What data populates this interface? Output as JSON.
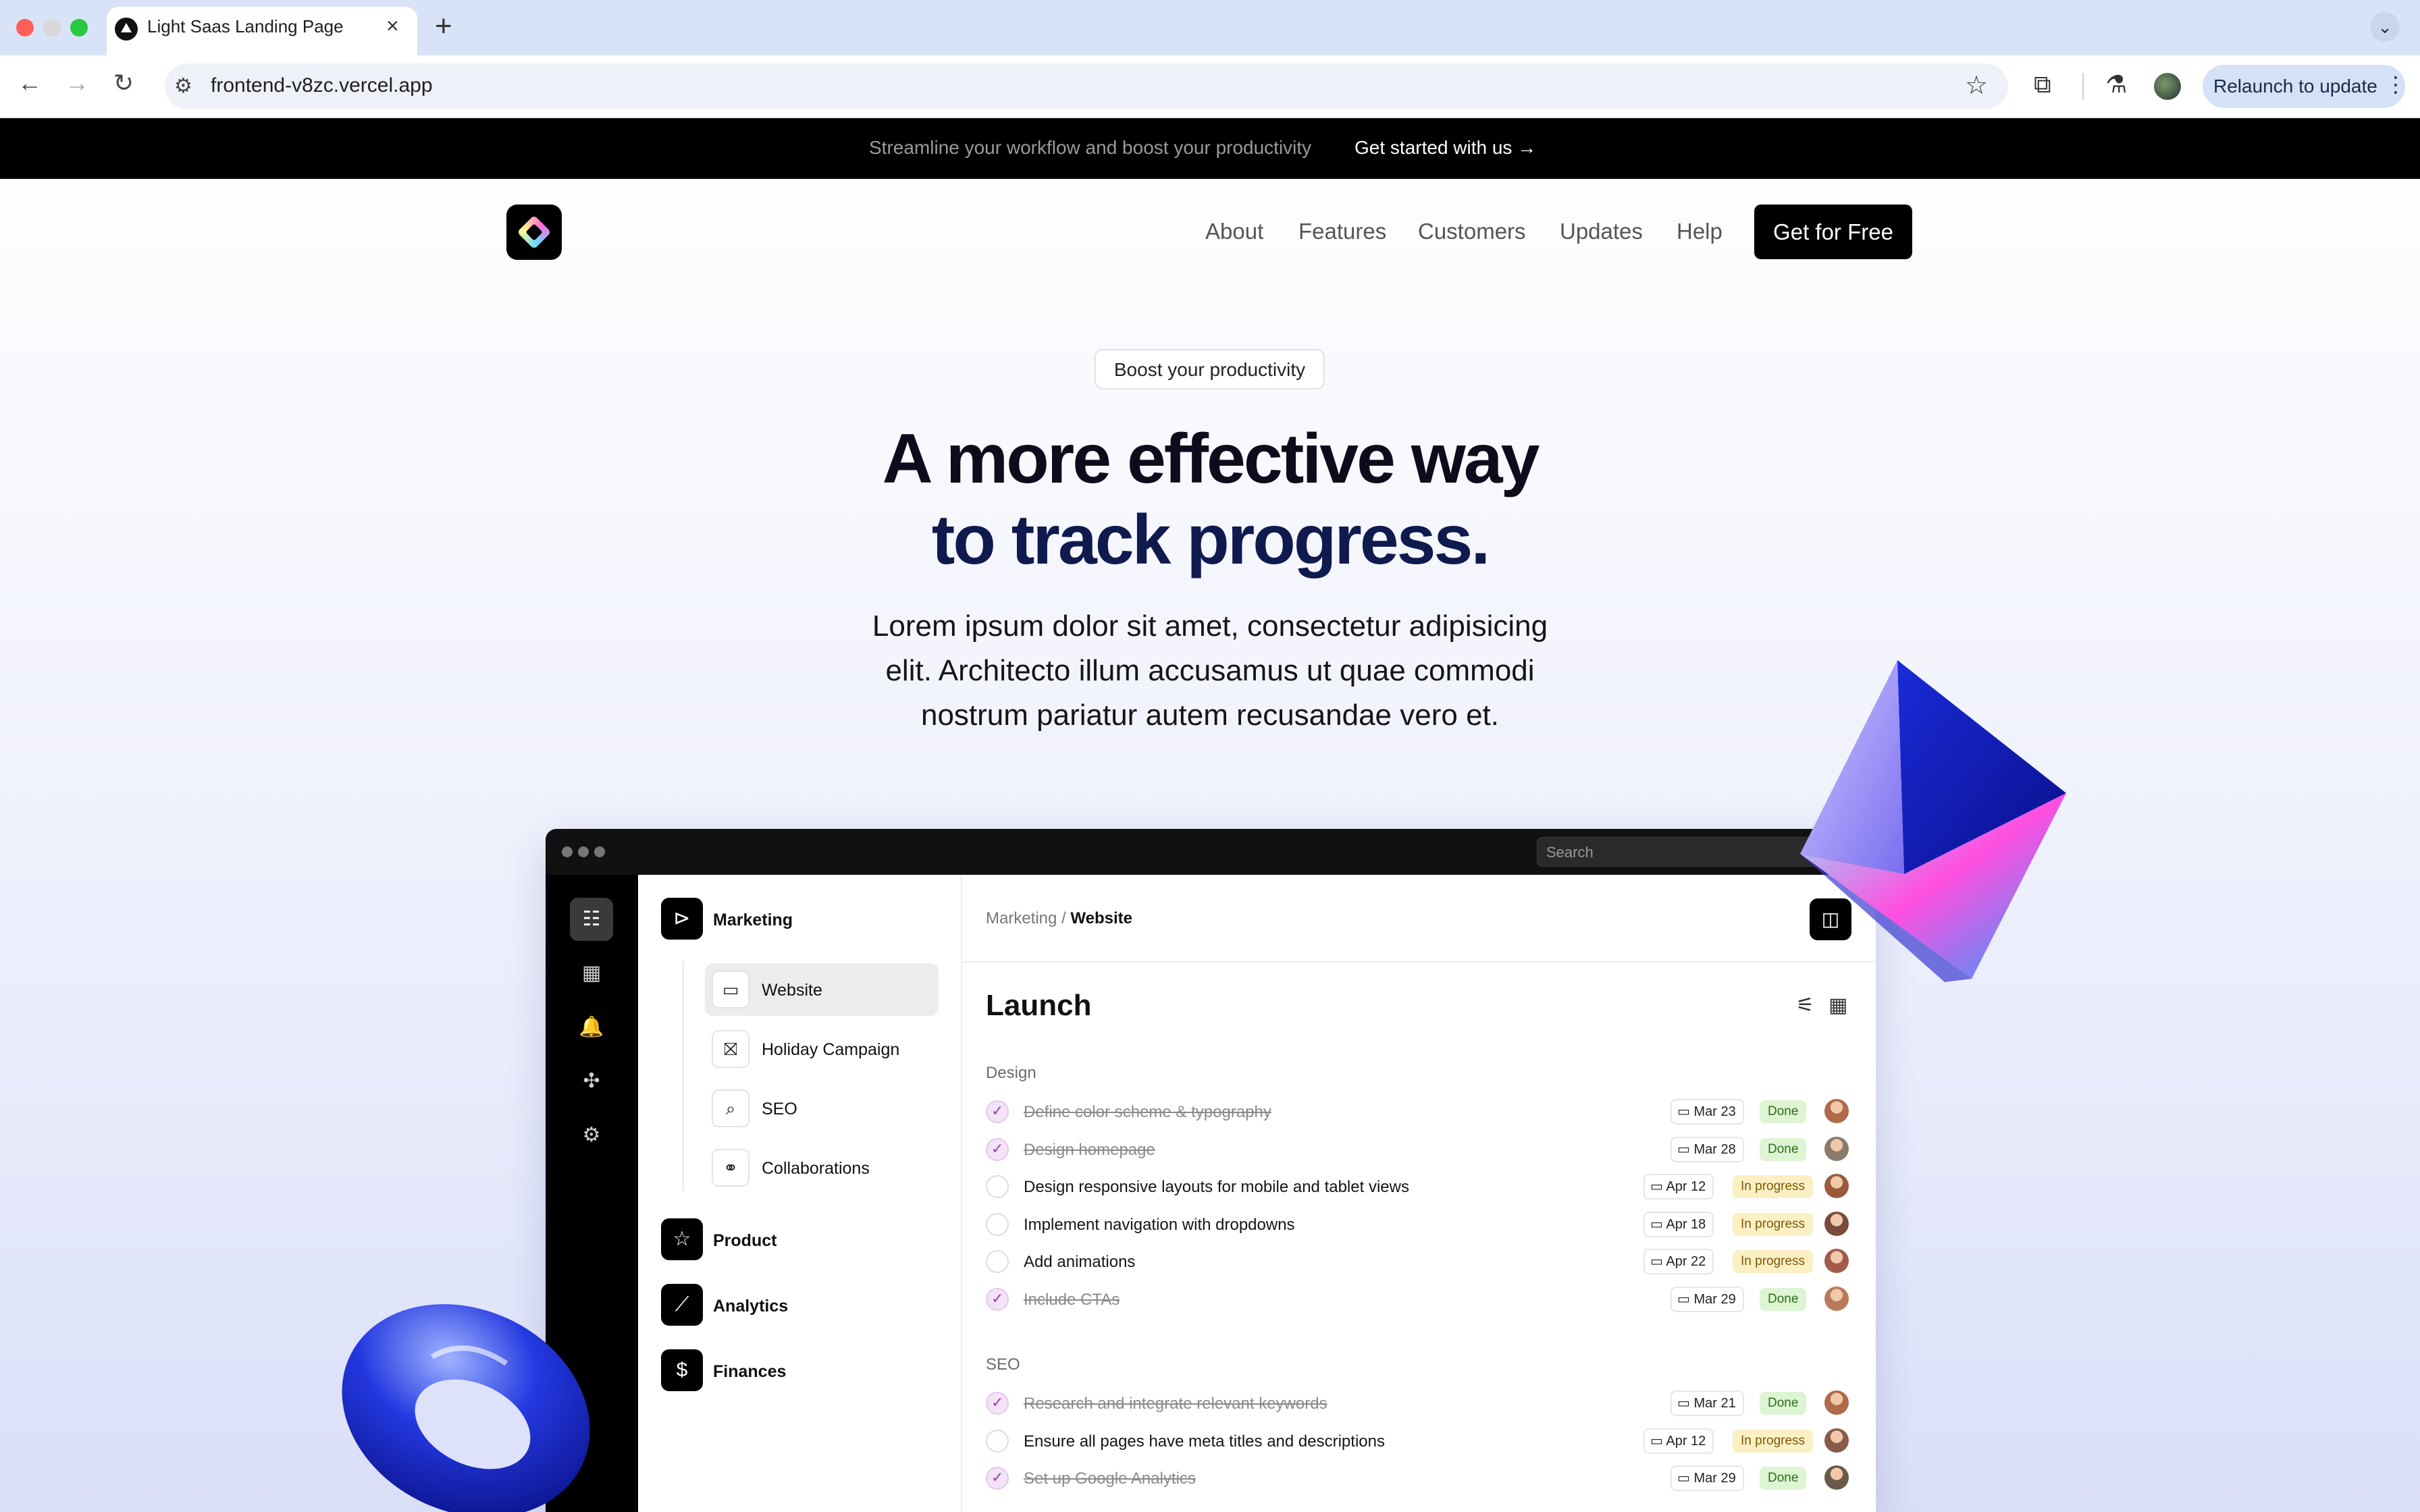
{
  "browser": {
    "tab_title": "Light Saas Landing Page",
    "tab_close": "×",
    "new_tab": "+",
    "tab_menu": "⌄",
    "url": "frontend-v8zc.vercel.app",
    "relaunch_label": "Relaunch to update",
    "icons": {
      "back": "←",
      "forward": "→",
      "reload": "↻",
      "site": "⚙",
      "bookmark": "☆",
      "extensions": "⧉",
      "labs": "⚗",
      "menu": "⋮"
    },
    "traffic_colors": [
      "#ff5f57",
      "#d8d8d8",
      "#28c840"
    ]
  },
  "announcement": {
    "text": "Streamline your workflow and boost your productivity",
    "link": "Get started with us →"
  },
  "nav": {
    "links": [
      "About",
      "Features",
      "Customers",
      "Updates",
      "Help"
    ],
    "cta": "Get for Free"
  },
  "hero": {
    "pill": "Boost your productivity",
    "title_line1": "A more effective way",
    "title_line2": "to track progress.",
    "subtitle": "Lorem ipsum dolor sit amet, consectetur adipisicing elit. Architecto illum accusamus ut quae commodi nostrum pariatur autem recusandae vero et."
  },
  "app": {
    "search_placeholder": "Search",
    "rail_icons": [
      "checklist-icon",
      "calendar-icon",
      "bell-icon",
      "puzzle-icon",
      "gear-icon"
    ],
    "rail_glyphs": [
      "☷",
      "▦",
      "🔔",
      "✣",
      "⚙"
    ],
    "sections": {
      "marketing": {
        "label": "Marketing",
        "glyph": "⊳"
      },
      "product": {
        "label": "Product",
        "glyph": "☆"
      },
      "analytics": {
        "label": "Analytics",
        "glyph": "⟋"
      },
      "finances": {
        "label": "Finances",
        "glyph": "$"
      }
    },
    "sub_items": [
      {
        "label": "Website",
        "glyph": "▭"
      },
      {
        "label": "Holiday Campaign",
        "glyph": "⛝"
      },
      {
        "label": "SEO",
        "glyph": "⌕"
      },
      {
        "label": "Collaborations",
        "glyph": "⚭"
      }
    ],
    "breadcrumb": {
      "parent": "Marketing /",
      "current": "Website"
    },
    "panel_glyph": "◫",
    "page_title": "Launch",
    "view_glyphs": {
      "filter": "⚟",
      "grid": "▦"
    },
    "groups": {
      "design": {
        "label": "Design",
        "tasks": [
          {
            "name": "Define color scheme & typography",
            "date": "Mar 23",
            "status": "Done",
            "done": true,
            "avatar": "#b06a4a"
          },
          {
            "name": "Design homepage",
            "date": "Mar 28",
            "status": "Done",
            "done": true,
            "avatar": "#8a7a6a"
          },
          {
            "name": "Design responsive layouts for mobile and tablet views",
            "date": "Apr 12",
            "status": "In progress",
            "done": false,
            "avatar": "#9a5a3a"
          },
          {
            "name": "Implement navigation with dropdowns",
            "date": "Apr 18",
            "status": "In progress",
            "done": false,
            "avatar": "#7a4a3a"
          },
          {
            "name": "Add animations",
            "date": "Apr 22",
            "status": "In progress",
            "done": false,
            "avatar": "#a45a4a"
          },
          {
            "name": "Include CTAs",
            "date": "Mar 29",
            "status": "Done",
            "done": true,
            "avatar": "#b87a5a"
          }
        ]
      },
      "seo": {
        "label": "SEO",
        "tasks": [
          {
            "name": "Research and integrate relevant keywords",
            "date": "Mar 21",
            "status": "Done",
            "done": true,
            "avatar": "#b06a4a"
          },
          {
            "name": "Ensure all pages have meta titles and descriptions",
            "date": "Apr 12",
            "status": "In progress",
            "done": false,
            "avatar": "#8a5a4a"
          },
          {
            "name": "Set up Google Analytics",
            "date": "Mar 29",
            "status": "Done",
            "done": true,
            "avatar": "#6a5a4a"
          }
        ]
      }
    }
  }
}
